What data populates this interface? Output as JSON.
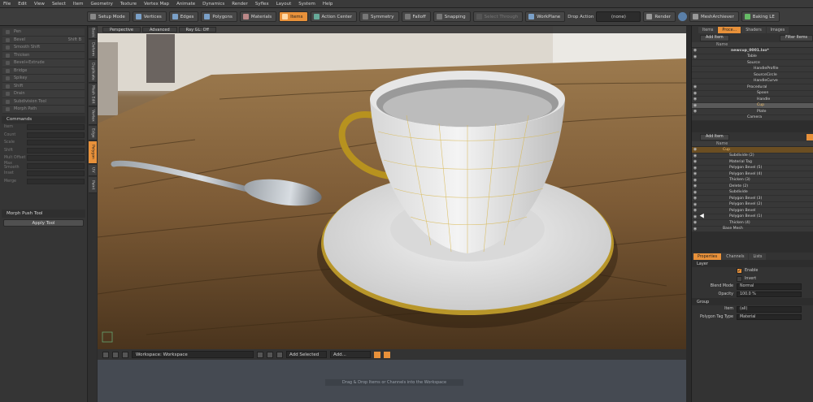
{
  "menubar": [
    "File",
    "Edit",
    "View",
    "Select",
    "Item",
    "Geometry",
    "Texture",
    "Vertex Map",
    "Animate",
    "Dynamics",
    "Render",
    "Syflex",
    "Layout",
    "System",
    "Help"
  ],
  "toolbar": {
    "setup_mode": "Setup Mode",
    "vertices": "Vertices",
    "edges": "Edges",
    "polygons": "Polygons",
    "materials": "Materials",
    "items": "Items",
    "action_center": "Action Center",
    "symmetry": "Symmetry",
    "falloff": "Falloff",
    "snapping": "Snapping",
    "select_through": "Select Through",
    "workplane": "WorkPlane",
    "drop_action_label": "Drop Action",
    "drop_action_value": "(none)",
    "render": "Render",
    "mesharchiever": "MeshArchiever",
    "baking": "Baking LE"
  },
  "left_tools": [
    {
      "label": "Pen",
      "key": ""
    },
    {
      "label": "Bevel",
      "key": "Shift B"
    },
    {
      "label": "Smooth Shift",
      "key": ""
    },
    {
      "label": "Thicken",
      "key": ""
    },
    {
      "label": "Bevel+Extrude",
      "key": ""
    },
    {
      "label": "Bridge",
      "key": ""
    },
    {
      "label": "Spikey",
      "key": ""
    },
    {
      "label": "Shift",
      "key": ""
    },
    {
      "label": "Drain",
      "key": ""
    },
    {
      "label": "Subdivision Tool",
      "key": ""
    },
    {
      "label": "Morph Path",
      "key": ""
    }
  ],
  "commands": {
    "title": "Commands",
    "rows": [
      {
        "label": "Item",
        "value": ""
      },
      {
        "label": "Count",
        "value": ""
      },
      {
        "label": "Scale",
        "value": ""
      },
      {
        "label": "Shift",
        "value": ""
      },
      {
        "label": "Mult Offset",
        "value": ""
      },
      {
        "label": "Max Smooth",
        "value": ""
      },
      {
        "label": "Inset",
        "value": ""
      },
      {
        "label": "Merge",
        "value": ""
      }
    ]
  },
  "morph_tool": {
    "title": "Morph Push Tool",
    "apply": "Apply Tool"
  },
  "vtabs": [
    "Basic",
    "Deform",
    "Duplicate",
    "Mesh Edit",
    "Vertex",
    "Edge",
    "Polygon",
    "UV",
    "Paint"
  ],
  "viewport": {
    "tabs": [
      "Perspective",
      "Advanced",
      "Ray GL: Off"
    ]
  },
  "workspace": {
    "select": "Workspace: Workspace",
    "add_selected": "Add Selected",
    "add": "Add...",
    "hint": "Drag & Drop Items or Channels into the Workspace"
  },
  "right_tabs": [
    "Items",
    "Proce...",
    "Shaders",
    "Images"
  ],
  "items_panel": {
    "add_item": "Add Item",
    "filter_items": "Filter Items",
    "col_name": "Name",
    "rows": [
      {
        "name": "newcup_0001.lxo*",
        "indent": 0,
        "style": "bold"
      },
      {
        "name": "Table",
        "indent": 1,
        "style": ""
      },
      {
        "name": "Source",
        "indent": 1,
        "style": ""
      },
      {
        "name": "HandleProfile",
        "indent": 2,
        "style": ""
      },
      {
        "name": "SourceCircle",
        "indent": 2,
        "style": ""
      },
      {
        "name": "HandleCurve",
        "indent": 2,
        "style": ""
      },
      {
        "name": "Procedural",
        "indent": 1,
        "style": ""
      },
      {
        "name": "Spoon",
        "indent": 2,
        "style": ""
      },
      {
        "name": "Handle",
        "indent": 2,
        "style": ""
      },
      {
        "name": "Cup",
        "indent": 2,
        "style": "cupsel"
      },
      {
        "name": "Plate",
        "indent": 2,
        "style": ""
      },
      {
        "name": "Camera",
        "indent": 1,
        "style": ""
      }
    ]
  },
  "mesh_ops": {
    "add_item": "Add Item",
    "col_name": "Name",
    "root": "Cup",
    "rows": [
      "Subdivide (2)",
      "Material Tag",
      "Polygon Bevel (5)",
      "Polygon Bevel (4)",
      "Thicken (3)",
      "Delete (2)",
      "Subdivide",
      "Polygon Bevel (3)",
      "Polygon Bevel (2)",
      "Polygon Bevel",
      "Polygon Bevel (1)",
      "Thicken (4)",
      "Base Mesh"
    ]
  },
  "properties": {
    "tabs": [
      "Properties",
      "Channels",
      "Lists"
    ],
    "layer_section": "Layer",
    "enable": "Enable",
    "invert": "Invert",
    "blend_mode_label": "Blend Mode",
    "blend_mode_value": "Normal",
    "opacity_label": "Opacity",
    "opacity_value": "100.0 %",
    "group_section": "Group",
    "item_label": "Item",
    "item_value": "(all)",
    "ptag_label": "Polygon Tag Type",
    "ptag_value": "Material"
  },
  "colors": {
    "accent": "#e8913a",
    "bg": "#2b2b2b",
    "panel": "#353535"
  }
}
